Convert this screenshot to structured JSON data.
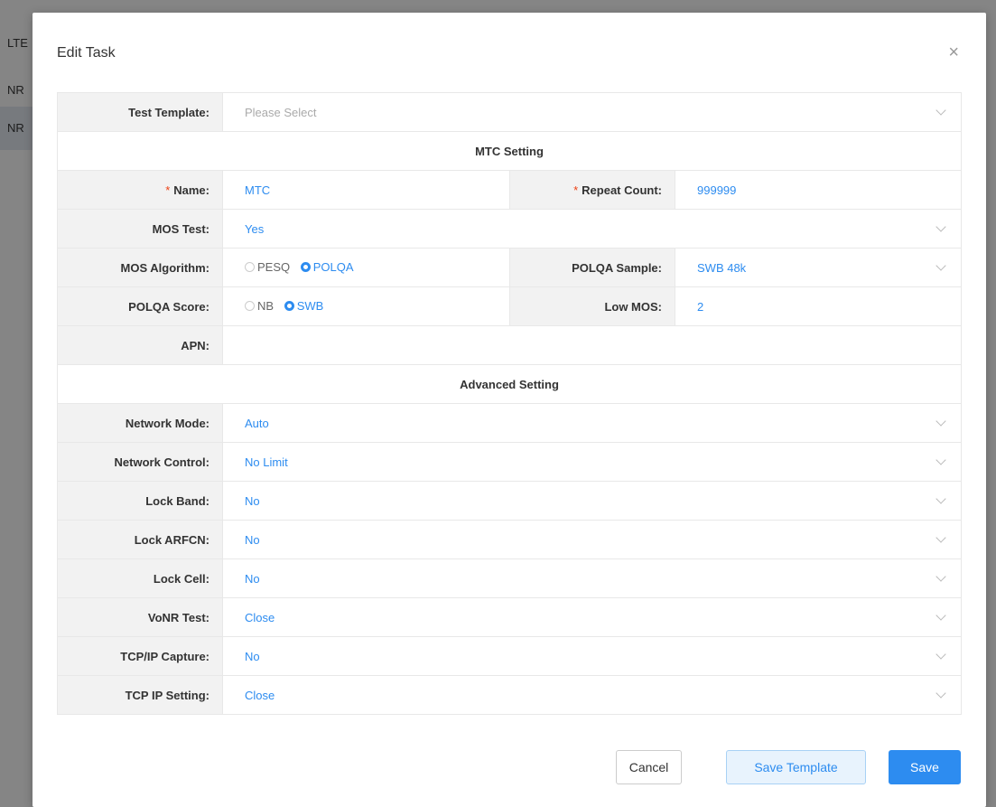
{
  "background": {
    "rows": [
      "LTE",
      "NR",
      "NR"
    ]
  },
  "modal": {
    "title": "Edit Task",
    "close_icon": "×"
  },
  "form": {
    "test_template": {
      "label": "Test Template:",
      "placeholder": "Please Select"
    },
    "mtc_section": "MTC Setting",
    "name": {
      "label": "Name:",
      "value": "MTC"
    },
    "repeat_count": {
      "label": "Repeat Count:",
      "value": "999999"
    },
    "required_mark": "*",
    "mos_test": {
      "label": "MOS Test:",
      "value": "Yes"
    },
    "mos_algorithm": {
      "label": "MOS Algorithm:",
      "options": [
        "PESQ",
        "POLQA"
      ],
      "selected": "POLQA"
    },
    "polqa_sample": {
      "label": "POLQA Sample:",
      "value": "SWB 48k"
    },
    "polqa_score": {
      "label": "POLQA Score:",
      "options": [
        "NB",
        "SWB"
      ],
      "selected": "SWB"
    },
    "low_mos": {
      "label": "Low MOS:",
      "value": "2"
    },
    "apn": {
      "label": "APN:",
      "value": ""
    },
    "advanced_section": "Advanced Setting",
    "network_mode": {
      "label": "Network Mode:",
      "value": "Auto"
    },
    "network_control": {
      "label": "Network Control:",
      "value": "No Limit"
    },
    "lock_band": {
      "label": "Lock Band:",
      "value": "No"
    },
    "lock_arfcn": {
      "label": "Lock ARFCN:",
      "value": "No"
    },
    "lock_cell": {
      "label": "Lock Cell:",
      "value": "No"
    },
    "vonr_test": {
      "label": "VoNR Test:",
      "value": "Close"
    },
    "tcpip_capture": {
      "label": "TCP/IP Capture:",
      "value": "No"
    },
    "tcp_ip_setting": {
      "label": "TCP IP Setting:",
      "value": "Close"
    }
  },
  "footer": {
    "cancel": "Cancel",
    "save_template": "Save Template",
    "save": "Save"
  },
  "colors": {
    "accent": "#2d8cf0",
    "required": "#ed4014",
    "label_bg": "#f2f2f2"
  }
}
